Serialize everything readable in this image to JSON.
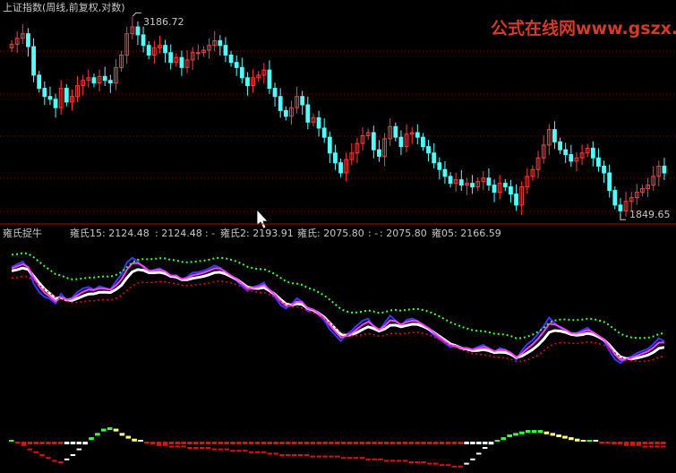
{
  "title": "上证指数(周线,前复权,对数)",
  "watermark": "公式在线网www.gszx.com.cn",
  "cursor_icon": "arrow-cursor-icon",
  "colors": {
    "background": "#000000",
    "up": "#ff3c3c",
    "down": "#54ffff",
    "white": "#ffffff",
    "magenta": "#ff40ff",
    "blue": "#3a3aff",
    "green": "#3cff3c",
    "red": "#e01010",
    "yellow": "#ffff80",
    "separator": "#c00000",
    "grid": "#8b0000"
  },
  "chart_data": [
    {
      "type": "candlestick",
      "title": "上证指数(周线,前复权,对数)",
      "annotations": [
        {
          "text": "3186.72",
          "label": "high"
        },
        {
          "text": "1849.65",
          "label": "low"
        }
      ],
      "high_value": 3186.72,
      "low_value": 1849.65,
      "ylim": [
        1800,
        3250
      ],
      "grid": true,
      "series": [
        {
          "name": "close",
          "values": [
            2970,
            3020,
            3060,
            2950,
            2720,
            2620,
            2560,
            2540,
            2480,
            2620,
            2520,
            2560,
            2640,
            2680,
            2700,
            2660,
            2710,
            2680,
            2660,
            2780,
            2880,
            3060,
            3120,
            3050,
            2960,
            2880,
            2940,
            2960,
            2900,
            2820,
            2860,
            2780,
            2840,
            2900,
            2900,
            2920,
            2960,
            3000,
            2960,
            2880,
            2820,
            2780,
            2700,
            2640,
            2700,
            2720,
            2760,
            2620,
            2560,
            2460,
            2420,
            2480,
            2560,
            2500,
            2380,
            2410,
            2340,
            2280,
            2180,
            2120,
            2060,
            2140,
            2180,
            2240,
            2290,
            2310,
            2200,
            2160,
            2270,
            2350,
            2280,
            2220,
            2300,
            2310,
            2280,
            2220,
            2180,
            2120,
            2080,
            2040,
            2000,
            2020,
            1990,
            2000,
            1980,
            2010,
            2030,
            1990,
            1950,
            2000,
            1980,
            1940,
            1880,
            1980,
            2040,
            2080,
            2150,
            2230,
            2330,
            2250,
            2200,
            2170,
            2130,
            2150,
            2180,
            2210,
            2150,
            2100,
            2060,
            1960,
            1880,
            1849.65,
            1900,
            1920,
            1950,
            1970,
            1990,
            2040,
            2100,
            2060
          ]
        }
      ]
    },
    {
      "type": "line",
      "title": "雍氏捉牛",
      "legend": [
        {
          "name": "雍氏15",
          "text": "雍氏15: 2124.48",
          "value": 2124.48,
          "color": "#3a3aff"
        },
        {
          "name": "magenta",
          "text": ": 2124.48",
          "value": 2124.48,
          "color": "#ff40ff"
        },
        {
          "name": "dash",
          "text": ": -",
          "color": "#c8c8c8"
        },
        {
          "name": "雍氏2",
          "text": "雍氏2: 2193.91",
          "value": 2193.91,
          "color": "#3a3aff"
        },
        {
          "name": "雍氏",
          "text": "雍氏: 2075.80",
          "value": 2075.8,
          "color": "#c8c8c8"
        },
        {
          "name": "dash2",
          "text": ": -",
          "color": "#c8c8c8"
        },
        {
          "name": "red",
          "text": ": 2075.80",
          "value": 2075.8,
          "color": "#ff3c3c"
        },
        {
          "name": "雍05",
          "text": "雍05: 2166.59",
          "value": 2166.59,
          "color": "#e6c56a"
        }
      ]
    },
    {
      "type": "bar",
      "title": "",
      "series": [
        {
          "name": "",
          "values": [
            0,
            -1,
            -3,
            -6,
            -8,
            -10,
            -12,
            -14,
            -15,
            -13,
            -10,
            -6,
            -2,
            3,
            6,
            9,
            10,
            9,
            6,
            4,
            2,
            1,
            -1,
            -2,
            -3,
            -3,
            -4,
            -4,
            -4,
            -5,
            -5,
            -5,
            -5,
            -6,
            -6,
            -6,
            -7,
            -7,
            -7,
            -8,
            -8,
            -8,
            -9,
            -9,
            -10,
            -10,
            -10,
            -10,
            -10,
            -11,
            -11,
            -11,
            -11,
            -11,
            -12,
            -12,
            -12,
            -12,
            -13,
            -13,
            -13,
            -14,
            -14,
            -14,
            -14,
            -15,
            -15,
            -15,
            -16,
            -16,
            -17,
            -17,
            -18,
            -18,
            -16,
            -13,
            -9,
            -5,
            -2,
            1,
            3,
            5,
            6,
            7,
            8,
            8,
            8,
            7,
            6,
            5,
            4,
            3,
            2,
            1,
            1,
            0,
            -1,
            -1,
            -2,
            -2,
            -3,
            -3,
            -3,
            -4,
            -4,
            -4,
            -4
          ]
        }
      ]
    }
  ]
}
